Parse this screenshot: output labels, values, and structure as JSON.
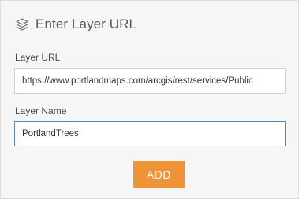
{
  "dialog": {
    "title": "Enter Layer URL",
    "icon": "layers-icon"
  },
  "fields": {
    "url": {
      "label": "Layer URL",
      "value": "https://www.portlandmaps.com/arcgis/rest/services/Public"
    },
    "name": {
      "label": "Layer Name",
      "value": "PortlandTrees"
    }
  },
  "actions": {
    "add_label": "ADD"
  },
  "colors": {
    "accent": "#ee9336",
    "focus_border": "#5a87b5",
    "panel_background": "#f6f6f6"
  }
}
